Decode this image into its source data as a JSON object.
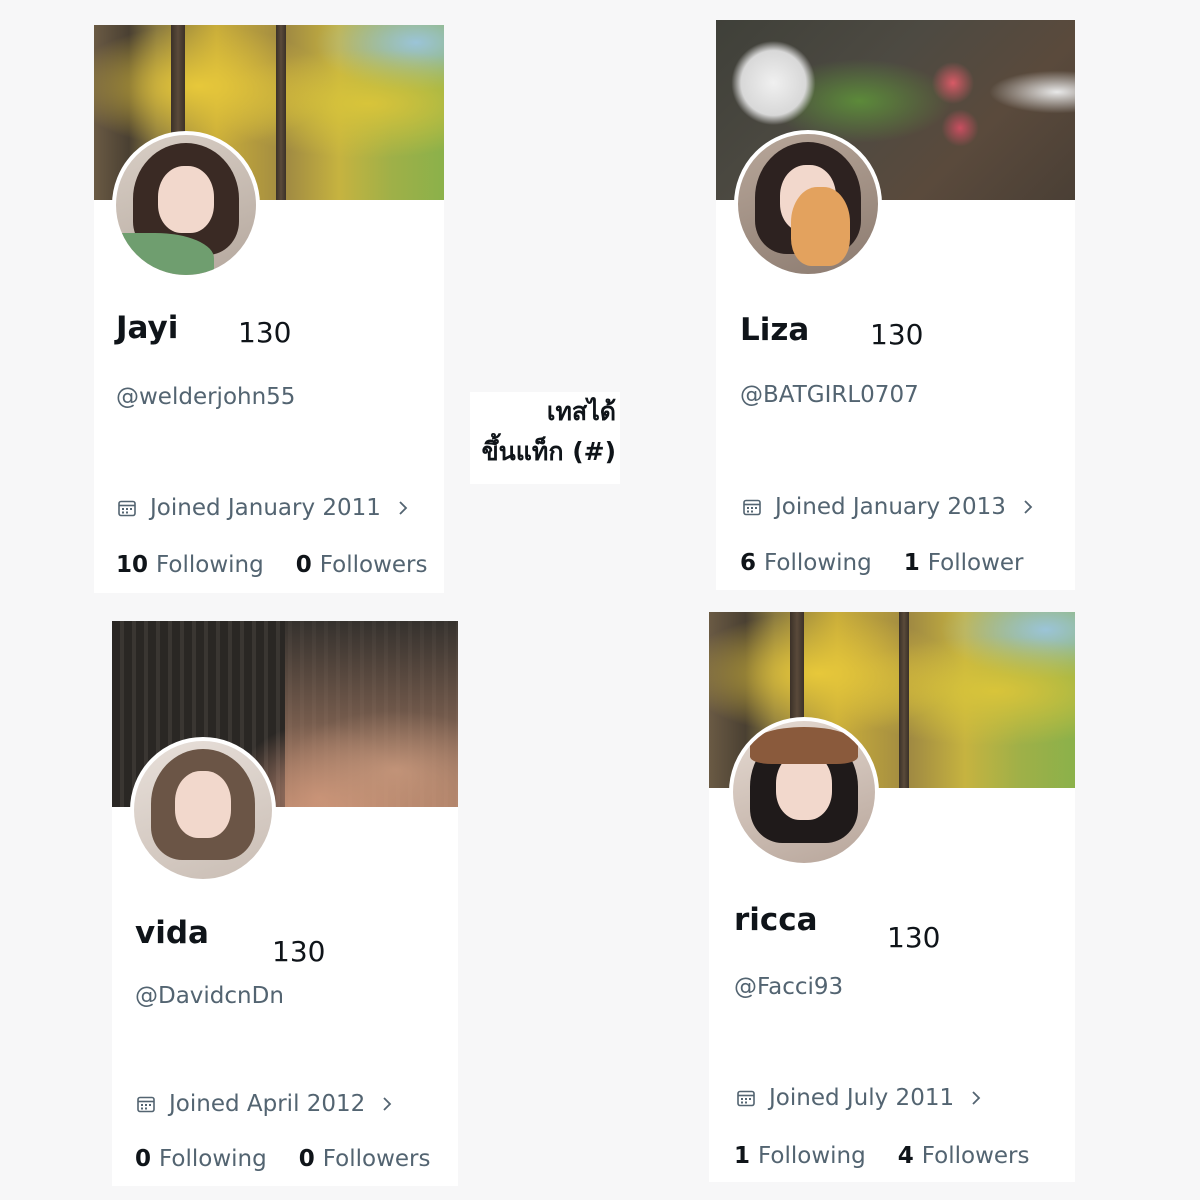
{
  "caption": {
    "line1": "เทสได้",
    "line2": "ขึ้นแท็ก (#)"
  },
  "profiles": [
    {
      "name": "Jayi",
      "count": "130",
      "handle": "@welderjohn55",
      "joined": "Joined January 2011",
      "following_count": "10",
      "following_label": "Following",
      "followers_count": "0",
      "followers_label": "Followers"
    },
    {
      "name": "Liza",
      "count": "130",
      "handle": "@BATGIRL0707",
      "joined": "Joined January 2013",
      "following_count": "6",
      "following_label": "Following",
      "followers_count": "1",
      "followers_label": "Follower"
    },
    {
      "name": "vida",
      "count": "130",
      "handle": "@DavidcnDn",
      "joined": "Joined April 2012",
      "following_count": "0",
      "following_label": "Following",
      "followers_count": "0",
      "followers_label": "Followers"
    },
    {
      "name": "ricca",
      "count": "130",
      "handle": "@Facci93",
      "joined": "Joined July 2011",
      "following_count": "1",
      "following_label": "Following",
      "followers_count": "4",
      "followers_label": "Followers"
    }
  ],
  "icons": {
    "calendar": "calendar-icon",
    "chevron": "chevron-right-icon"
  },
  "colors": {
    "name": "#0f1419",
    "secondary": "#536471"
  }
}
